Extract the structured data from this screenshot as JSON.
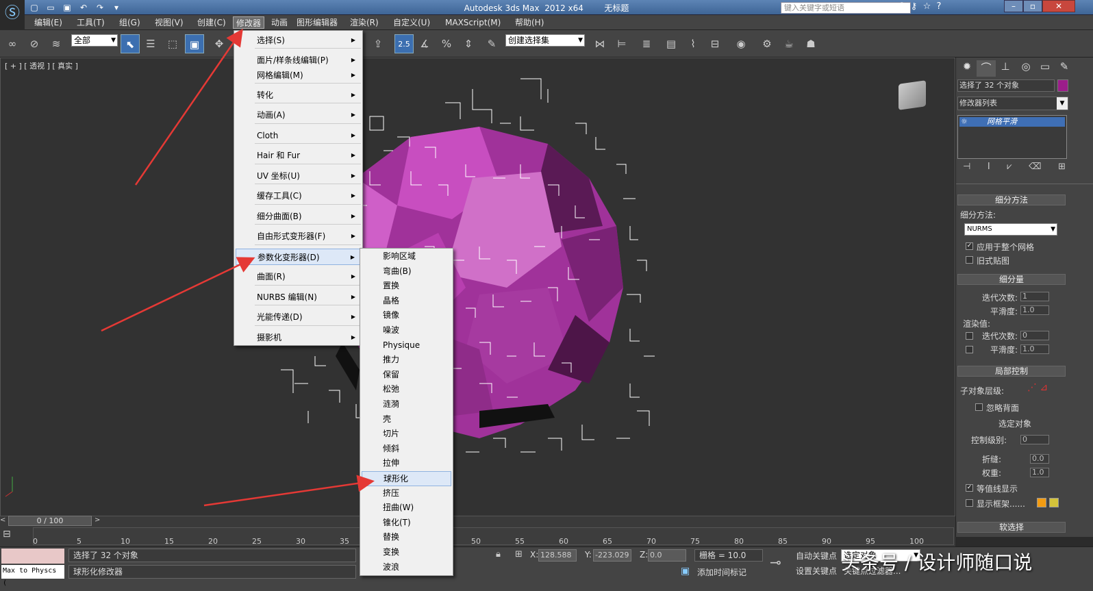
{
  "window": {
    "title": "Autodesk 3ds Max  2012 x64        无标题",
    "search_placeholder": "键入关键字或短语"
  },
  "menubar": [
    "编辑(E)",
    "工具(T)",
    "组(G)",
    "视图(V)",
    "创建(C)",
    "修改器",
    "动画",
    "图形编辑器",
    "渲染(R)",
    "自定义(U)",
    "MAXScript(M)",
    "帮助(H)"
  ],
  "toolbar": {
    "filter": "全部",
    "selection_set": "创建选择集",
    "snap_value": "2.5"
  },
  "viewport": {
    "label": "[ + ] [ 透视 ] [ 真实 ]"
  },
  "modifier_menu": [
    {
      "label": "选择(S)"
    },
    {
      "label": "面片/样条线编辑(P)"
    },
    {
      "label": "网格编辑(M)"
    },
    {
      "label": "转化"
    },
    {
      "label": "动画(A)"
    },
    {
      "label": "Cloth"
    },
    {
      "label": "Hair 和 Fur"
    },
    {
      "label": "UV 坐标(U)"
    },
    {
      "label": "缓存工具(C)"
    },
    {
      "label": "细分曲面(B)"
    },
    {
      "label": "自由形式变形器(F)"
    },
    {
      "label": "参数化变形器(D)"
    },
    {
      "label": "曲面(R)"
    },
    {
      "label": "NURBS 编辑(N)"
    },
    {
      "label": "光能传递(D)"
    },
    {
      "label": "摄影机"
    }
  ],
  "parametric_submenu": [
    "影响区域",
    "弯曲(B)",
    "置换",
    "晶格",
    "镜像",
    "噪波",
    "Physique",
    "推力",
    "保留",
    "松弛",
    "涟漪",
    "壳",
    "切片",
    "倾斜",
    "拉伸",
    "球形化",
    "挤压",
    "扭曲(W)",
    "锥化(T)",
    "替换",
    "变换",
    "波浪"
  ],
  "command_panel": {
    "selection_text": "选择了 32 个对象",
    "modifier_list": "修改器列表",
    "stack_item": "网格平滑",
    "roll_subdiv_method": "细分方法",
    "subdiv_method_label": "细分方法:",
    "subdiv_method_value": "NURMS",
    "apply_whole_mesh": "应用于整个网格",
    "old_mapping": "旧式贴图",
    "roll_subdiv_amount": "细分量",
    "iterations_label": "迭代次数:",
    "iterations": "1",
    "smoothness_label": "平滑度:",
    "smoothness": "1.0",
    "render_values": "渲染值:",
    "render_iterations": "0",
    "render_smoothness": "1.0",
    "roll_local_control": "局部控制",
    "subobject_level": "子对象层级:",
    "ignore_backfacing": "忽略背面",
    "object_selected": "选定对象",
    "control_level_label": "控制级别:",
    "control_level": "0",
    "crease_label": "折缝:",
    "crease": "0.0",
    "weight_label": "权重:",
    "weight": "1.0",
    "isoline_display": "等值线显示",
    "show_cage": "显示框架......",
    "roll_soft_selection": "软选择",
    "color_accent": "#9b1d8a"
  },
  "timeline": {
    "frame": "0 / 100",
    "ticks": [
      "0",
      "5",
      "10",
      "15",
      "20",
      "25",
      "30",
      "35",
      "40",
      "45",
      "50",
      "55",
      "60",
      "65",
      "70",
      "75",
      "80",
      "85",
      "90",
      "95",
      "100"
    ]
  },
  "status": {
    "script_label": "Max to Physcs (",
    "selected": "选择了 32 个对象",
    "prompt": "球形化修改器",
    "x_label": "X:",
    "x": "128.588",
    "y_label": "Y:",
    "y": "-223.029",
    "z_label": "Z:",
    "z": "0.0",
    "grid": "栅格 = 10.0",
    "auto_key": "自动关键点",
    "set_key": "设置关键点",
    "selected_obj": "选定对象",
    "add_time_tag": "添加时间标记",
    "key_filter": "关键点过滤器..."
  },
  "watermark": "头条号 / 设计师随口说"
}
